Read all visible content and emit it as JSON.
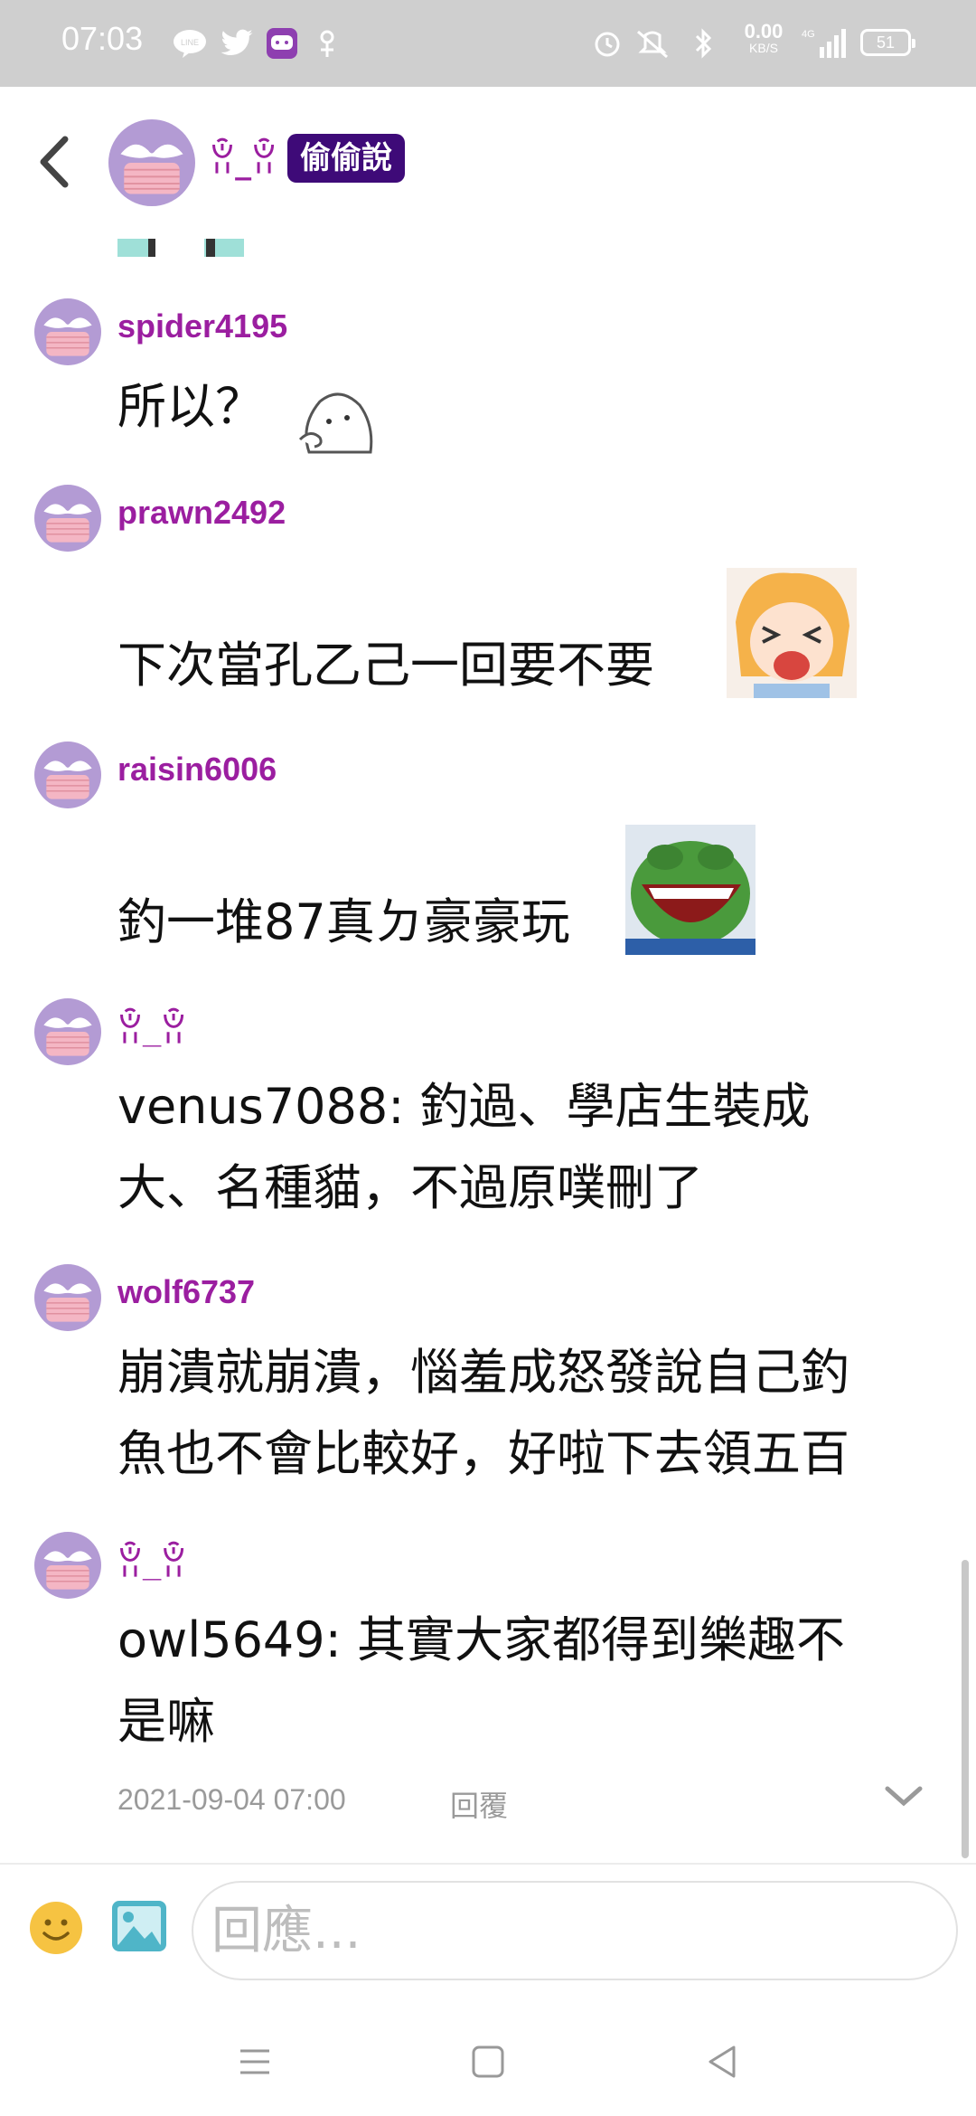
{
  "status_bar": {
    "time": "07:03",
    "notification_icons": [
      "line-icon",
      "twitter-icon",
      "chat-app-icon",
      "pinwheel-icon"
    ],
    "system_icons": [
      "alarm-icon",
      "mute-icon",
      "bluetooth-icon",
      "signal-icon"
    ],
    "speed_value": "0.00",
    "speed_unit": "KB/S",
    "network": "4G",
    "battery": "51"
  },
  "header": {
    "name": "ꂧ_ꂧ",
    "badge": "偷偷說"
  },
  "messages": [
    {
      "user": "spider4195",
      "lines": [
        "所以？"
      ],
      "sticker": "ghost-thinking-sticker"
    },
    {
      "user": "prawn2492",
      "lines": [
        "下次當孔乙己一回要不要"
      ],
      "sticker": "anime-girl-crying-sticker"
    },
    {
      "user": "raisin6006",
      "lines": [
        "釣一堆87真ㄉ豪豪玩"
      ],
      "sticker": "pepe-laughing-sticker"
    },
    {
      "user": "ꂧ_ꂧ",
      "lines": [
        "venus7088: 釣過、學店生裝成",
        "大、名種貓，不過原噗刪了"
      ]
    },
    {
      "user": "wolf6737",
      "lines": [
        "崩潰就崩潰，惱羞成怒發說自己釣",
        "魚也不會比較好，好啦下去領五百"
      ]
    },
    {
      "user": "ꂧ_ꂧ",
      "lines": [
        "owl5649: 其實大家都得到樂趣不",
        "是嘛"
      ]
    }
  ],
  "meta": {
    "date": "2021-09-04 07:00",
    "reply_label": "回覆"
  },
  "input": {
    "placeholder": "回應..."
  },
  "colors": {
    "username": "#9b1ea0",
    "badge_bg": "#3e0a78",
    "status_bar_bg": "#cfcfcf"
  }
}
